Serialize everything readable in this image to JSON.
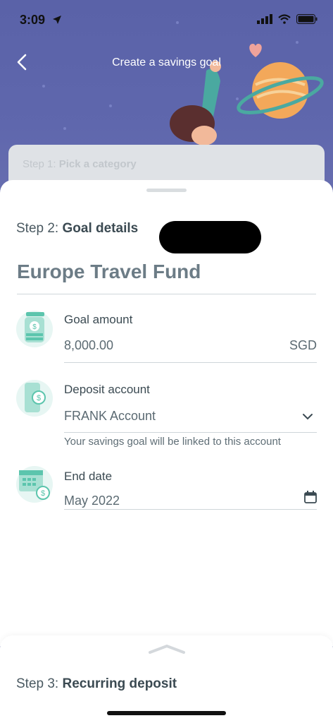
{
  "status_bar": {
    "time": "3:09"
  },
  "header": {
    "title": "Create a savings goal"
  },
  "step1": {
    "label": "Step 1: ",
    "value": "Pick a category"
  },
  "step2": {
    "prefix": "Step 2: ",
    "label": "Goal details"
  },
  "goal": {
    "name": "Europe Travel Fund"
  },
  "goal_amount": {
    "label": "Goal amount",
    "value": "8,000.00",
    "currency": "SGD"
  },
  "deposit_account": {
    "label": "Deposit account",
    "value": "FRANK Account",
    "helper": "Your savings goal will be linked to this account"
  },
  "end_date": {
    "label": "End date",
    "value": "May 2022"
  },
  "step3": {
    "prefix": "Step 3: ",
    "label": "Recurring deposit"
  },
  "colors": {
    "accent": "#5cc5ad",
    "hero": "#5a62a8"
  }
}
